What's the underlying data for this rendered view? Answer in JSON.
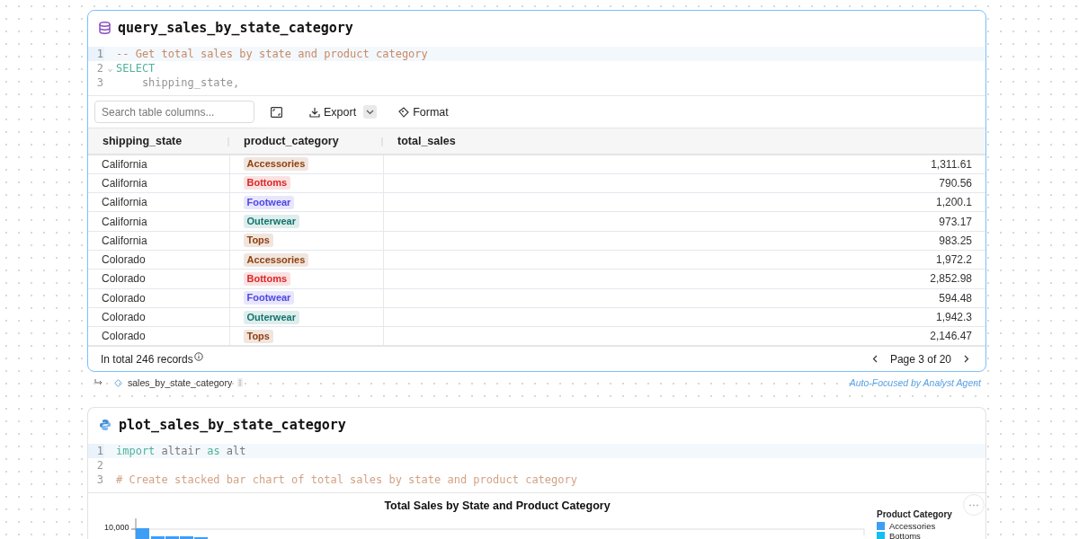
{
  "query_cell": {
    "title": "query_sales_by_state_category",
    "focused": true,
    "code": [
      {
        "number": "1",
        "active": true,
        "tokens": [
          {
            "kind": "comment",
            "text": "-- Get total sales by state and product category"
          }
        ]
      },
      {
        "number": "2",
        "active": false,
        "fold_icon": "⌄",
        "tokens": [
          {
            "kind": "keyword",
            "text": "SELECT"
          }
        ]
      },
      {
        "number": "3",
        "active": false,
        "tokens": [
          {
            "kind": "plain",
            "text": "    shipping_state,"
          }
        ]
      }
    ],
    "toolbar": {
      "search_placeholder": "Search table columns...",
      "export_label": "Export",
      "format_label": "Format"
    },
    "table": {
      "columns": [
        "shipping_state",
        "product_category",
        "total_sales"
      ],
      "rows": [
        {
          "state": "California",
          "category": {
            "text": "Accessories",
            "color": "#92400e"
          },
          "total": "1,311.61"
        },
        {
          "state": "California",
          "category": {
            "text": "Bottoms",
            "color": "#dc2626"
          },
          "total": "790.56"
        },
        {
          "state": "California",
          "category": {
            "text": "Footwear",
            "color": "#4f46e5"
          },
          "total": "1,200.1"
        },
        {
          "state": "California",
          "category": {
            "text": "Outerwear",
            "color": "#0f766e"
          },
          "total": "973.17"
        },
        {
          "state": "California",
          "category": {
            "text": "Tops",
            "color": "#92400e"
          },
          "total": "983.25"
        },
        {
          "state": "Colorado",
          "category": {
            "text": "Accessories",
            "color": "#92400e"
          },
          "total": "1,972.2"
        },
        {
          "state": "Colorado",
          "category": {
            "text": "Bottoms",
            "color": "#dc2626"
          },
          "total": "2,852.98"
        },
        {
          "state": "Colorado",
          "category": {
            "text": "Footwear",
            "color": "#4f46e5"
          },
          "total": "594.48"
        },
        {
          "state": "Colorado",
          "category": {
            "text": "Outerwear",
            "color": "#0f766e"
          },
          "total": "1,942.3"
        },
        {
          "state": "Colorado",
          "category": {
            "text": "Tops",
            "color": "#92400e"
          },
          "total": "2,146.47"
        }
      ]
    },
    "footer": {
      "records": "In total 246 records",
      "page": "Page 3 of 20"
    }
  },
  "output_link": {
    "name": "sales_by_state_category",
    "note": "Auto-Focused by Analyst Agent"
  },
  "plot_cell": {
    "title": "plot_sales_by_state_category",
    "focused": false,
    "code": [
      {
        "number": "1",
        "active": true,
        "tokens": [
          {
            "kind": "keyword",
            "text": "import"
          },
          {
            "kind": "plain",
            "text": " altair "
          },
          {
            "kind": "keyword",
            "text": "as"
          },
          {
            "kind": "plain",
            "text": " alt"
          }
        ]
      },
      {
        "number": "2",
        "active": false
      },
      {
        "number": "3",
        "active": false,
        "tokens": [
          {
            "kind": "comment",
            "text": "# Create stacked bar chart of total sales by state and product category"
          }
        ]
      }
    ],
    "chart": {
      "title": "Total Sales by State and Product Category",
      "ytick": "10,000",
      "legend_title": "Product Category",
      "legend": [
        {
          "label": "Accessories",
          "color": "#3e9ef5"
        },
        {
          "label": "Bottoms",
          "color": "#10c0f0"
        }
      ]
    }
  }
}
